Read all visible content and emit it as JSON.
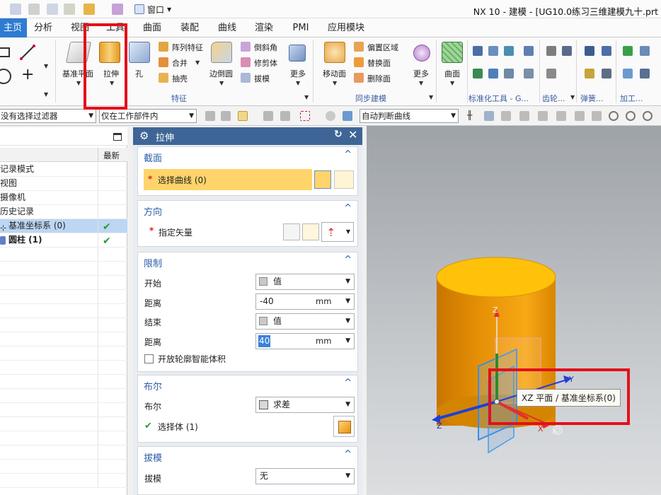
{
  "window": {
    "title": "NX 10 - 建模 - [UG10.0练习三维建模九十.prt",
    "window_menu": "窗口"
  },
  "tabs": [
    "主页",
    "分析",
    "视图",
    "工具",
    "曲面",
    "装配",
    "曲线",
    "渲染",
    "PMI",
    "应用模块"
  ],
  "ribbon": {
    "datum_plane": "基准平面",
    "extrude": "拉伸",
    "hole": "孔",
    "pattern_feature": "阵列特征",
    "unite": "合并",
    "shell": "抽壳",
    "edge_blend": "边倒圆",
    "chamfer": "倒斜角",
    "trim_body": "修剪体",
    "draft": "拔模",
    "more1": "更多",
    "move_face": "移动面",
    "offset_region": "偏置区域",
    "replace_face": "替换面",
    "delete_face": "删除面",
    "more2": "更多",
    "surface": "曲面",
    "groups": {
      "feature": "特征",
      "sync_modeling": "同步建模",
      "standard_parts": "标准化工具 - G...",
      "gear": "齿轮...",
      "spring": "弹簧...",
      "machining": "加工..."
    }
  },
  "filterbar": {
    "selection_filter": "没有选择过滤器",
    "scope": "仅在工作部件内",
    "curve_rule": "自动判断曲线"
  },
  "navigator": {
    "col_latest": "最新",
    "rows": [
      {
        "label": "记录模式"
      },
      {
        "label": "视图"
      },
      {
        "label": "摄像机"
      },
      {
        "label": "历史记录"
      },
      {
        "label": "基准坐标系 (0)"
      },
      {
        "label": "圆柱 (1)"
      }
    ]
  },
  "dialog": {
    "title": "拉伸",
    "section_profile": {
      "title": "截面",
      "select_curve": "选择曲线 (0)"
    },
    "section_direction": {
      "title": "方向",
      "specify_vector": "指定矢量"
    },
    "section_limits": {
      "title": "限制",
      "start_label": "开始",
      "start_value": "值",
      "start_distance_label": "距离",
      "start_distance": "-40",
      "end_label": "结束",
      "end_value": "值",
      "end_distance_label": "距离",
      "end_distance": "40",
      "unit": "mm",
      "open_profile": "开放轮廓智能体积"
    },
    "section_boolean": {
      "title": "布尔",
      "boolean_label": "布尔",
      "boolean_value": "求差",
      "select_body": "选择体 (1)"
    },
    "section_draft": {
      "title": "拔模",
      "draft_label": "拔模",
      "draft_value": "无"
    }
  },
  "viewport": {
    "tooltip": "XZ 平面 / 基准坐标系(0)",
    "axis_z": "Z",
    "axis_y": "Y",
    "axis_x": "X",
    "triad_z": "Z",
    "triad_x": "X"
  },
  "colors": {
    "accent": "#2e7bd1",
    "dialog_title": "#3e6596",
    "highlight_box": "#e3101a",
    "cylinder": "#f0a30a"
  }
}
